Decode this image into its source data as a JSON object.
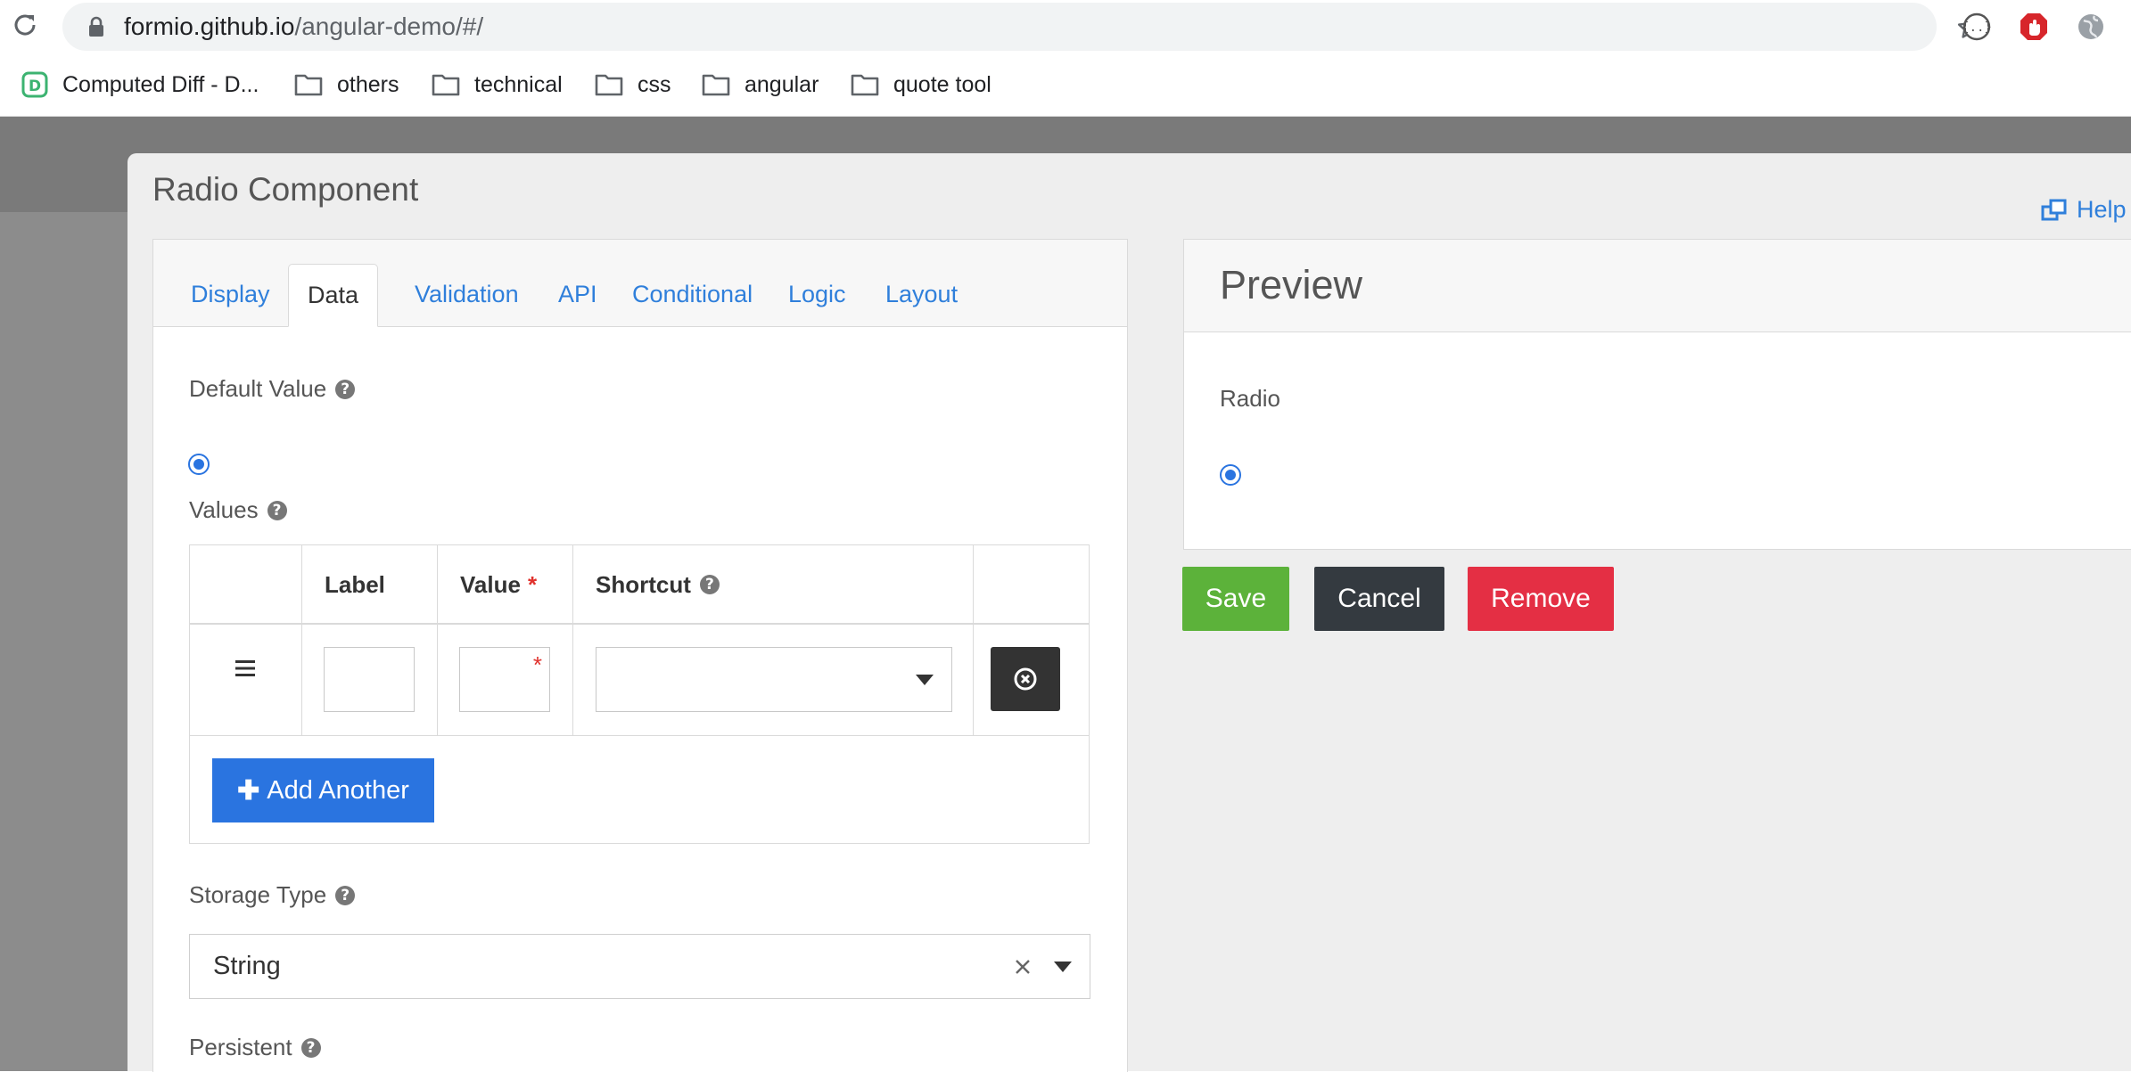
{
  "browser": {
    "url_host": "formio.github.io",
    "url_path": "/angular-demo/#/",
    "extensions": [
      "json-viewer-icon",
      "adblock-icon",
      "globe-icon"
    ]
  },
  "bookmarks": [
    {
      "label": "Computed Diff - D...",
      "icon": "diff-favicon-icon"
    },
    {
      "label": "others",
      "icon": "folder-icon"
    },
    {
      "label": "technical",
      "icon": "folder-icon"
    },
    {
      "label": "css",
      "icon": "folder-icon"
    },
    {
      "label": "angular",
      "icon": "folder-icon"
    },
    {
      "label": "quote tool",
      "icon": "folder-icon"
    }
  ],
  "modal": {
    "title": "Radio Component",
    "help": "Help",
    "tabs": [
      "Display",
      "Data",
      "Validation",
      "API",
      "Conditional",
      "Logic",
      "Layout"
    ],
    "active_tab": "Data",
    "default_value_label": "Default Value",
    "values_label": "Values",
    "values_table": {
      "headers": {
        "label": "Label",
        "value": "Value",
        "shortcut": "Shortcut"
      },
      "required_mark": "*",
      "rows": [
        {
          "label": "",
          "value": "",
          "shortcut": ""
        }
      ],
      "add_another": "Add Another"
    },
    "storage_type_label": "Storage Type",
    "storage_type_value": "String",
    "persistent_label": "Persistent",
    "help_mark": "?"
  },
  "preview": {
    "title": "Preview",
    "radio_label": "Radio"
  },
  "actions": {
    "save": "Save",
    "cancel": "Cancel",
    "remove": "Remove"
  },
  "colors": {
    "link_blue": "#2f7fdb",
    "primary": "#2a74e0",
    "save": "#5cb23a",
    "cancel": "#343a40",
    "remove": "#e42f44",
    "backdrop": "#8c8c8c"
  }
}
